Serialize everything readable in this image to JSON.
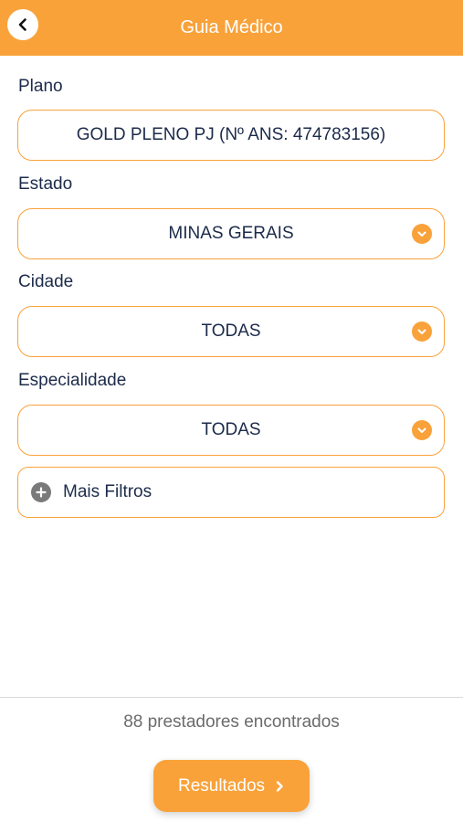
{
  "header": {
    "title": "Guia Médico",
    "back_icon": "chevron-left-icon"
  },
  "form": {
    "plano": {
      "label": "Plano",
      "value": "GOLD PLENO PJ (Nº ANS: 474783156)"
    },
    "estado": {
      "label": "Estado",
      "value": "MINAS GERAIS"
    },
    "cidade": {
      "label": "Cidade",
      "value": "TODAS"
    },
    "especialidade": {
      "label": "Especialidade",
      "value": "TODAS"
    },
    "more_filters": {
      "label": "Mais Filtros",
      "icon": "plus-circle-icon"
    }
  },
  "footer": {
    "count_text": "88 prestadores encontrados",
    "results_label": "Resultados"
  },
  "colors": {
    "accent": "#f9a23a",
    "text": "#1c2b4a",
    "muted": "#6b6b6b"
  }
}
